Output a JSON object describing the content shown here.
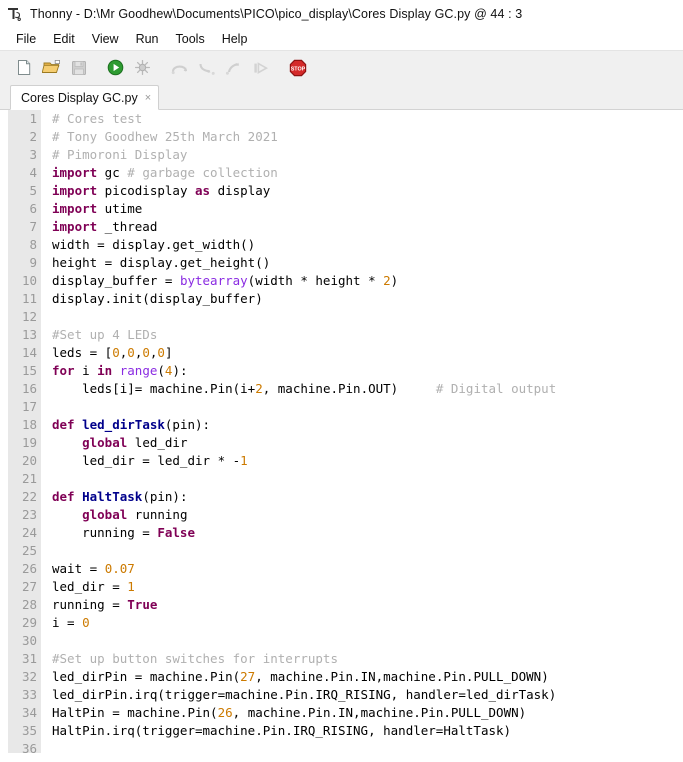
{
  "window": {
    "app_name": "Thonny",
    "separator": "-",
    "file_path": "D:\\Mr Goodhew\\Documents\\PICO\\pico_display\\Cores Display GC.py",
    "cursor_marker": "@",
    "cursor_position": "44 : 3",
    "title": "Thonny  -  D:\\Mr Goodhew\\Documents\\PICO\\pico_display\\Cores Display GC.py  @  44 : 3",
    "icon": "thonny-logo-icon"
  },
  "menubar": {
    "items": [
      {
        "label": "File",
        "name": "menu-file"
      },
      {
        "label": "Edit",
        "name": "menu-edit"
      },
      {
        "label": "View",
        "name": "menu-view"
      },
      {
        "label": "Run",
        "name": "menu-run"
      },
      {
        "label": "Tools",
        "name": "menu-tools"
      },
      {
        "label": "Help",
        "name": "menu-help"
      }
    ]
  },
  "toolbar": {
    "buttons": [
      {
        "name": "new-file-icon",
        "tooltip": "New",
        "enabled": true
      },
      {
        "name": "open-file-icon",
        "tooltip": "Load",
        "enabled": true
      },
      {
        "name": "save-file-icon",
        "tooltip": "Save",
        "enabled": false
      },
      {
        "name": "run-icon",
        "tooltip": "Run current script",
        "enabled": true
      },
      {
        "name": "debug-icon",
        "tooltip": "Debug current script",
        "enabled": false
      },
      {
        "name": "step-over-icon",
        "tooltip": "Step over",
        "enabled": false
      },
      {
        "name": "step-into-icon",
        "tooltip": "Step into",
        "enabled": false
      },
      {
        "name": "step-out-icon",
        "tooltip": "Step out",
        "enabled": false
      },
      {
        "name": "resume-icon",
        "tooltip": "Resume",
        "enabled": false
      },
      {
        "name": "stop-icon",
        "tooltip": "Stop/Restart backend",
        "enabled": true
      }
    ]
  },
  "tabs": {
    "active_index": 0,
    "items": [
      {
        "label": "Cores Display GC.py",
        "close_glyph": "×"
      }
    ]
  },
  "editor": {
    "line_count": 36,
    "lines": [
      {
        "n": "1",
        "tokens": [
          {
            "t": "# Cores test",
            "c": "com"
          }
        ]
      },
      {
        "n": "2",
        "tokens": [
          {
            "t": "# Tony Goodhew 25th March 2021",
            "c": "com"
          }
        ]
      },
      {
        "n": "3",
        "tokens": [
          {
            "t": "# Pimoroni Display",
            "c": "com"
          }
        ]
      },
      {
        "n": "4",
        "tokens": [
          {
            "t": "import",
            "c": "kw"
          },
          {
            "t": " gc ",
            "c": ""
          },
          {
            "t": "# garbage collection",
            "c": "com"
          }
        ]
      },
      {
        "n": "5",
        "tokens": [
          {
            "t": "import",
            "c": "kw"
          },
          {
            "t": " picodisplay ",
            "c": ""
          },
          {
            "t": "as",
            "c": "kw"
          },
          {
            "t": " display",
            "c": ""
          }
        ]
      },
      {
        "n": "6",
        "tokens": [
          {
            "t": "import",
            "c": "kw"
          },
          {
            "t": " utime",
            "c": ""
          }
        ]
      },
      {
        "n": "7",
        "tokens": [
          {
            "t": "import",
            "c": "kw"
          },
          {
            "t": " _thread",
            "c": ""
          }
        ]
      },
      {
        "n": "8",
        "tokens": [
          {
            "t": "width = display.get_width()",
            "c": ""
          }
        ]
      },
      {
        "n": "9",
        "tokens": [
          {
            "t": "height = display.get_height()",
            "c": ""
          }
        ]
      },
      {
        "n": "10",
        "tokens": [
          {
            "t": "display_buffer = ",
            "c": ""
          },
          {
            "t": "bytearray",
            "c": "bi"
          },
          {
            "t": "(width * height * ",
            "c": ""
          },
          {
            "t": "2",
            "c": "num"
          },
          {
            "t": ")",
            "c": ""
          }
        ]
      },
      {
        "n": "11",
        "tokens": [
          {
            "t": "display.init(display_buffer)",
            "c": ""
          }
        ]
      },
      {
        "n": "12",
        "tokens": []
      },
      {
        "n": "13",
        "tokens": [
          {
            "t": "#Set up 4 LEDs",
            "c": "com"
          }
        ]
      },
      {
        "n": "14",
        "tokens": [
          {
            "t": "leds = [",
            "c": ""
          },
          {
            "t": "0",
            "c": "num"
          },
          {
            "t": ",",
            "c": ""
          },
          {
            "t": "0",
            "c": "num"
          },
          {
            "t": ",",
            "c": ""
          },
          {
            "t": "0",
            "c": "num"
          },
          {
            "t": ",",
            "c": ""
          },
          {
            "t": "0",
            "c": "num"
          },
          {
            "t": "]",
            "c": ""
          }
        ]
      },
      {
        "n": "15",
        "tokens": [
          {
            "t": "for",
            "c": "kw"
          },
          {
            "t": " i ",
            "c": ""
          },
          {
            "t": "in",
            "c": "kw"
          },
          {
            "t": " ",
            "c": ""
          },
          {
            "t": "range",
            "c": "bi"
          },
          {
            "t": "(",
            "c": ""
          },
          {
            "t": "4",
            "c": "num"
          },
          {
            "t": "):",
            "c": ""
          }
        ]
      },
      {
        "n": "16",
        "tokens": [
          {
            "t": "    leds[i]= machine.Pin(i+",
            "c": ""
          },
          {
            "t": "2",
            "c": "num"
          },
          {
            "t": ", machine.Pin.OUT)     ",
            "c": ""
          },
          {
            "t": "# Digital output",
            "c": "com"
          }
        ]
      },
      {
        "n": "17",
        "tokens": []
      },
      {
        "n": "18",
        "tokens": [
          {
            "t": "def",
            "c": "kw"
          },
          {
            "t": " ",
            "c": ""
          },
          {
            "t": "led_dirTask",
            "c": "def"
          },
          {
            "t": "(pin):",
            "c": ""
          }
        ]
      },
      {
        "n": "19",
        "tokens": [
          {
            "t": "    ",
            "c": ""
          },
          {
            "t": "global",
            "c": "kw"
          },
          {
            "t": " led_dir",
            "c": ""
          }
        ]
      },
      {
        "n": "20",
        "tokens": [
          {
            "t": "    led_dir = led_dir * -",
            "c": ""
          },
          {
            "t": "1",
            "c": "num"
          }
        ]
      },
      {
        "n": "21",
        "tokens": []
      },
      {
        "n": "22",
        "tokens": [
          {
            "t": "def",
            "c": "kw"
          },
          {
            "t": " ",
            "c": ""
          },
          {
            "t": "HaltTask",
            "c": "def"
          },
          {
            "t": "(pin):",
            "c": ""
          }
        ]
      },
      {
        "n": "23",
        "tokens": [
          {
            "t": "    ",
            "c": ""
          },
          {
            "t": "global",
            "c": "kw"
          },
          {
            "t": " running",
            "c": ""
          }
        ]
      },
      {
        "n": "24",
        "tokens": [
          {
            "t": "    running = ",
            "c": ""
          },
          {
            "t": "False",
            "c": "kw"
          }
        ]
      },
      {
        "n": "25",
        "tokens": []
      },
      {
        "n": "26",
        "tokens": [
          {
            "t": "wait = ",
            "c": ""
          },
          {
            "t": "0.07",
            "c": "num"
          }
        ]
      },
      {
        "n": "27",
        "tokens": [
          {
            "t": "led_dir = ",
            "c": ""
          },
          {
            "t": "1",
            "c": "num"
          }
        ]
      },
      {
        "n": "28",
        "tokens": [
          {
            "t": "running = ",
            "c": ""
          },
          {
            "t": "True",
            "c": "kw"
          }
        ]
      },
      {
        "n": "29",
        "tokens": [
          {
            "t": "i = ",
            "c": ""
          },
          {
            "t": "0",
            "c": "num"
          }
        ]
      },
      {
        "n": "30",
        "tokens": []
      },
      {
        "n": "31",
        "tokens": [
          {
            "t": "#Set up button switches for interrupts",
            "c": "com"
          }
        ]
      },
      {
        "n": "32",
        "tokens": [
          {
            "t": "led_dirPin = machine.Pin(",
            "c": ""
          },
          {
            "t": "27",
            "c": "num"
          },
          {
            "t": ", machine.Pin.IN,machine.Pin.PULL_DOWN)",
            "c": ""
          }
        ]
      },
      {
        "n": "33",
        "tokens": [
          {
            "t": "led_dirPin.irq(trigger=machine.Pin.IRQ_RISING, handler=led_dirTask)",
            "c": ""
          }
        ]
      },
      {
        "n": "34",
        "tokens": [
          {
            "t": "HaltPin = machine.Pin(",
            "c": ""
          },
          {
            "t": "26",
            "c": "num"
          },
          {
            "t": ", machine.Pin.IN,machine.Pin.PULL_DOWN)",
            "c": ""
          }
        ]
      },
      {
        "n": "35",
        "tokens": [
          {
            "t": "HaltPin.irq(trigger=machine.Pin.IRQ_RISING, handler=HaltTask)",
            "c": ""
          }
        ]
      },
      {
        "n": "36",
        "tokens": []
      }
    ]
  },
  "colors": {
    "comment": "#b0b0b0",
    "keyword": "#7f0055",
    "definition": "#00008b",
    "number": "#cc7a00",
    "builtin": "#8a2be2",
    "gutter_bg": "#e8e8e8",
    "toolbar_bg": "#f0f0f0",
    "editor_bg": "#ffffff",
    "run_icon": "#2e9b31",
    "stop_icon": "#d42a2a",
    "folder_icon": "#e8b44a"
  }
}
